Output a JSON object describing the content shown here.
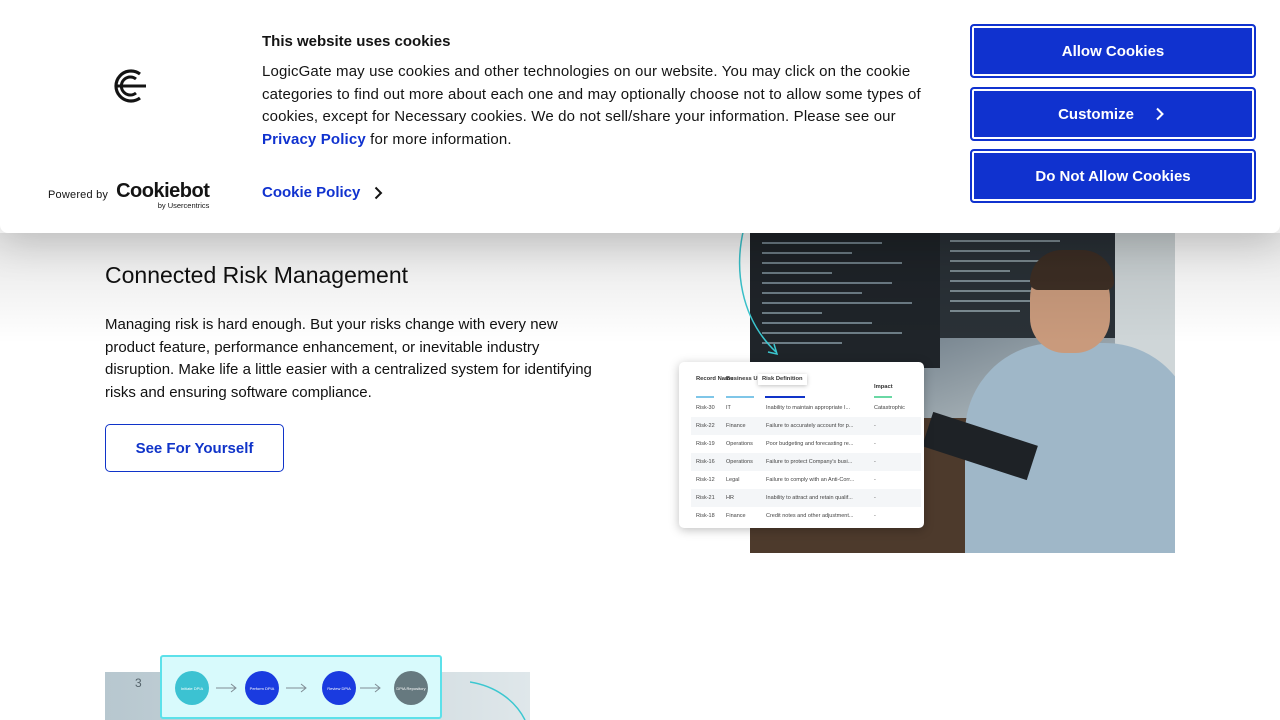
{
  "cookie_banner": {
    "title": "This website uses cookies",
    "body_before_link": "LogicGate may use cookies and other technologies on our website. You may click on the cookie categories to find out more about each one and may optionally choose not to allow some types of cookies, except for Necessary cookies.  We do not sell/share your information. Please see our ",
    "privacy_link": "Privacy Policy",
    "body_after_link": " for more information.",
    "cookie_policy_link": "Cookie Policy",
    "powered_by": "Powered by",
    "cookiebot_name": "Cookiebot",
    "cookiebot_sub": "by Usercentrics",
    "buttons": {
      "allow": "Allow Cookies",
      "customize": "Customize",
      "deny": "Do Not Allow Cookies"
    },
    "accent_color": "#1032cf"
  },
  "hero": {
    "title": "Connected Risk Management",
    "text": "Managing risk is hard enough. But your risks change with every new product feature, performance enhancement, or inevitable industry disruption. Make life a little easier with a centralized system for identifying risks and ensuring software compliance.",
    "cta": "See For Yourself"
  },
  "risk_table": {
    "headers": [
      "Record Name",
      "Business Unit",
      "Risk Definition",
      "Impact"
    ],
    "rows": [
      [
        "Risk-30",
        "IT",
        "Inability to maintain appropriate I...",
        "Catastrophic"
      ],
      [
        "Risk-22",
        "Finance",
        "Failure to accurately account for p...",
        "-"
      ],
      [
        "Risk-19",
        "Operations",
        "Poor budgeting and forecasting re...",
        "-"
      ],
      [
        "Risk-16",
        "Operations",
        "Failure to protect Company's busi...",
        "-"
      ],
      [
        "Risk-12",
        "Legal",
        "Failure to comply with an Anti-Corr...",
        "-"
      ],
      [
        "Risk-21",
        "HR",
        "Inability to attract and retain qualif...",
        "-"
      ],
      [
        "Risk-18",
        "Finance",
        "Credit notes and other adjustment...",
        "-"
      ]
    ]
  },
  "flow_diagram": {
    "step_number": "3",
    "nodes": [
      "Initiate DPIA",
      "Perform DPIA",
      "Review DPIA",
      "DPIA Repository"
    ]
  }
}
